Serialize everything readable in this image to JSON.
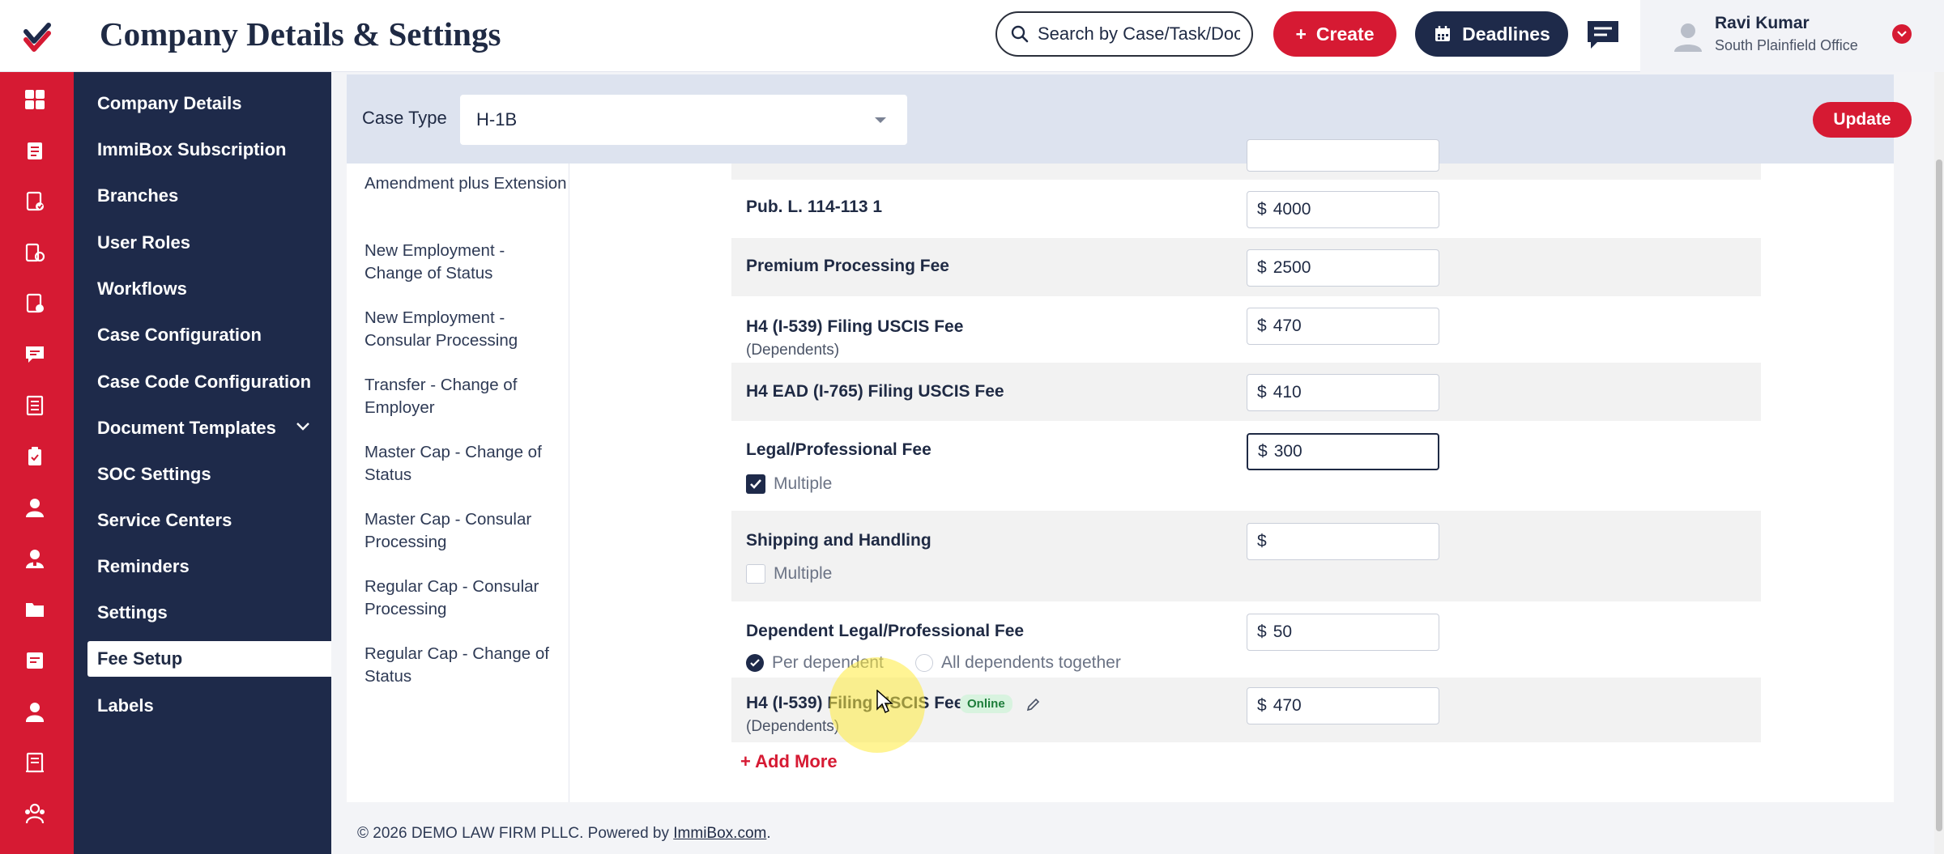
{
  "header": {
    "title": "Company Details & Settings",
    "search_placeholder": "Search by Case/Task/Document",
    "create_label": "Create",
    "deadlines_label": "Deadlines",
    "user_name": "Ravi Kumar",
    "user_office": "South Plainfield Office"
  },
  "icon_rail": [
    "dashboard-icon",
    "cases-icon",
    "tasks-icon",
    "forms-icon",
    "documents-icon",
    "messages-icon",
    "reports-icon",
    "checklist-icon",
    "contacts-icon",
    "clients-icon",
    "folder-icon",
    "notes-icon",
    "employees-icon",
    "ledger-icon",
    "team-icon"
  ],
  "sidebar": {
    "items": [
      {
        "label": "Company Details"
      },
      {
        "label": "ImmiBox Subscription"
      },
      {
        "label": "Branches"
      },
      {
        "label": "User Roles"
      },
      {
        "label": "Workflows"
      },
      {
        "label": "Case Configuration"
      },
      {
        "label": "Case Code Configuration"
      },
      {
        "label": "Document Templates"
      },
      {
        "label": "SOC Settings"
      },
      {
        "label": "Service Centers"
      },
      {
        "label": "Reminders"
      },
      {
        "label": "Settings"
      },
      {
        "label": "Fee Setup",
        "active": true
      },
      {
        "label": "Labels"
      }
    ]
  },
  "case_type": {
    "label": "Case Type",
    "value": "H-1B"
  },
  "update_label": "Update",
  "subtypes": [
    "Amendment plus Extension",
    "New Employment - Change of Status",
    "New Employment - Consular Processing",
    "Transfer - Change of Employer",
    "Master Cap - Change of Status",
    "Master Cap - Consular Processing",
    "Regular Cap - Consular Processing",
    "Regular Cap - Change of Status"
  ],
  "currency_symbol": "$",
  "fees": [
    {
      "label": "Pub. L. 114-113 1",
      "value": "4000"
    },
    {
      "label": "Premium Processing Fee",
      "value": "2500"
    },
    {
      "label": "H4 (I-539) Filing USCIS Fee",
      "sub": "(Dependents)",
      "value": "470"
    },
    {
      "label": "H4 EAD (I-765) Filing USCIS Fee",
      "value": "410"
    },
    {
      "label": "Legal/Professional Fee",
      "value": "300",
      "checkbox_label": "Multiple",
      "checked": true
    },
    {
      "label": "Shipping and Handling",
      "value": "",
      "checkbox_label": "Multiple",
      "checked": false
    },
    {
      "label": "Dependent Legal/Professional Fee",
      "value": "50",
      "radio_1": "Per dependent",
      "radio_2": "All dependents together",
      "selected": "Per dependent"
    },
    {
      "label": "H4 (I-539) Filing USCIS Fee",
      "sub": "(Dependents)",
      "value": "470",
      "badge": "Online"
    }
  ],
  "add_more_label": "+ Add More",
  "footer": {
    "text": "© 2026 DEMO LAW FIRM PLLC. Powered by",
    "link": "ImmiBox.com",
    "suffix": "."
  },
  "colors": {
    "brand_red": "#d61a33",
    "navy": "#1e2a4a",
    "online_green": "#1d7d3a"
  }
}
